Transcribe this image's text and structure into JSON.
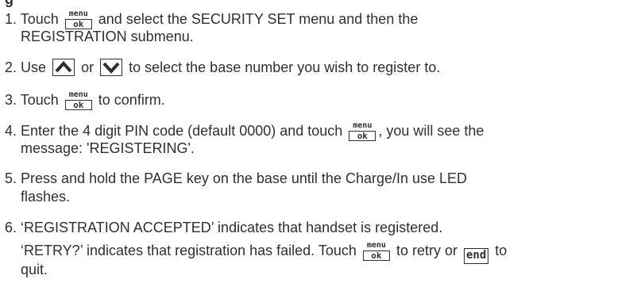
{
  "heading_fragment": "g",
  "steps": [
    {
      "num": "1.",
      "pre": "Touch",
      "post": "and select the SECURITY SET menu and then the",
      "cont": "REGISTRATION submenu."
    },
    {
      "num": "2.",
      "pre": "Use",
      "mid": "or",
      "post": "to select the base number you wish to register to."
    },
    {
      "num": "3.",
      "pre": "Touch",
      "post": "to confirm."
    },
    {
      "num": "4.",
      "pre": "Enter the 4 digit PIN code (default 0000) and touch",
      "post": ", you will see the",
      "cont": "message: 'REGISTERING'."
    },
    {
      "num": "5.",
      "text": "Press and hold the PAGE key on the base until the Charge/In use LED",
      "cont": "flashes."
    },
    {
      "num": "6.",
      "text": "‘REGISTRATION ACCEPTED’ indicates that handset is registered.",
      "cont_pre": "‘RETRY?’ indicates that registration has failed. Touch",
      "cont_mid": "to retry or",
      "cont_post": "to",
      "cont2": "quit."
    }
  ],
  "keys": {
    "menu_top": "menu",
    "menu_bottom": "ok",
    "end": "end"
  },
  "icons": {
    "up": "chevron-up-icon",
    "down": "chevron-down-icon"
  },
  "colors": {
    "text": "#2f2f2f"
  }
}
